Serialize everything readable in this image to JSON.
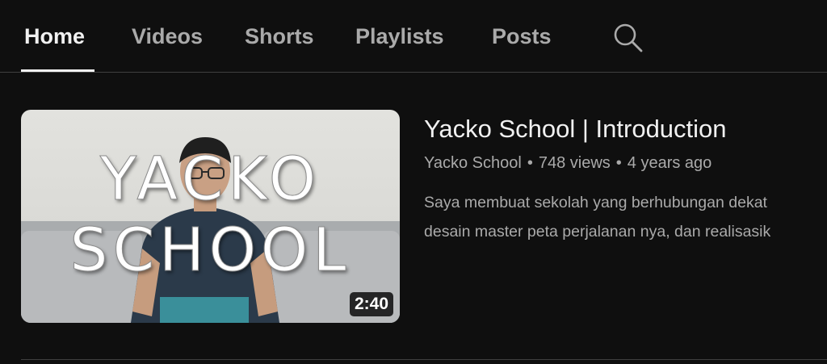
{
  "tabs": {
    "home": "Home",
    "videos": "Videos",
    "shorts": "Shorts",
    "playlists": "Playlists",
    "posts": "Posts",
    "search_icon": "search-icon"
  },
  "video": {
    "thumbnail_line1": "YACKO",
    "thumbnail_line2": "SCHOOL",
    "duration": "2:40",
    "title": "Yacko School | Introduction",
    "channel": "Yacko School",
    "views": "748 views",
    "age": "4 years ago",
    "separator": "•",
    "description_line1": "Saya membuat sekolah yang berhubungan dekat",
    "description_line2": "desain master peta perjalanan nya, dan realisasik"
  },
  "colors": {
    "background": "#0f0f0f",
    "text_primary": "#f1f1f1",
    "text_secondary": "#aaaaaa",
    "divider": "#3f3f3f"
  }
}
